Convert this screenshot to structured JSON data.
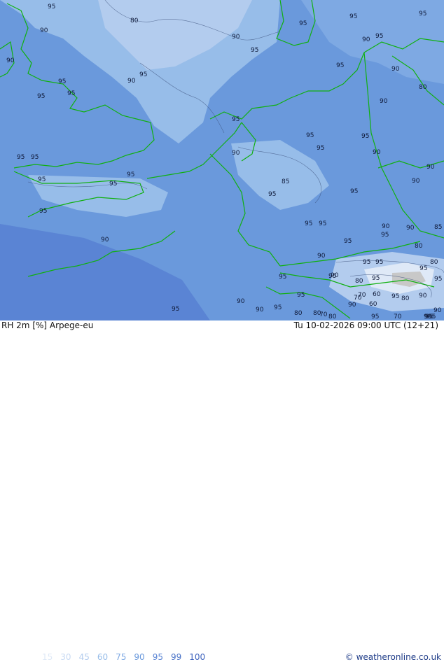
{
  "map": {
    "title_left": "RH 2m [%] Arpege-eu",
    "title_right": "Tu 10-02-2026 09:00 UTC (12+21)",
    "credit": "© weatheronline.co.uk",
    "legend": [
      {
        "value": "15",
        "color": "#dfe9f7"
      },
      {
        "value": "30",
        "color": "#c8daf3"
      },
      {
        "value": "45",
        "color": "#b3ccee"
      },
      {
        "value": "60",
        "color": "#97bde9"
      },
      {
        "value": "75",
        "color": "#7ea9e3"
      },
      {
        "value": "90",
        "color": "#6a99dc"
      },
      {
        "value": "95",
        "color": "#5a84d4"
      },
      {
        "value": "99",
        "color": "#4a73c8"
      },
      {
        "value": "100",
        "color": "#3d62bd"
      }
    ],
    "contour_labels": [
      "95",
      "80",
      "90",
      "90",
      "95",
      "95",
      "95",
      "95",
      "90",
      "95",
      "90",
      "95",
      "95",
      "90",
      "95",
      "90",
      "80",
      "95",
      "95",
      "90",
      "95",
      "95",
      "95",
      "95",
      "90",
      "95",
      "95",
      "90",
      "90",
      "95",
      "90",
      "95",
      "95",
      "85",
      "95",
      "95",
      "95",
      "90",
      "95",
      "95",
      "90",
      "80",
      "90",
      "95",
      "95",
      "85",
      "90",
      "95",
      "95",
      "80",
      "95",
      "95",
      "95",
      "80",
      "95",
      "90",
      "95",
      "70",
      "90",
      "95",
      "95",
      "70",
      "60",
      "80",
      "95",
      "80",
      "80",
      "90",
      "70",
      "60",
      "90",
      "80",
      "90",
      "95",
      "90",
      "95",
      "95",
      "70",
      "90",
      "95",
      "95"
    ]
  }
}
